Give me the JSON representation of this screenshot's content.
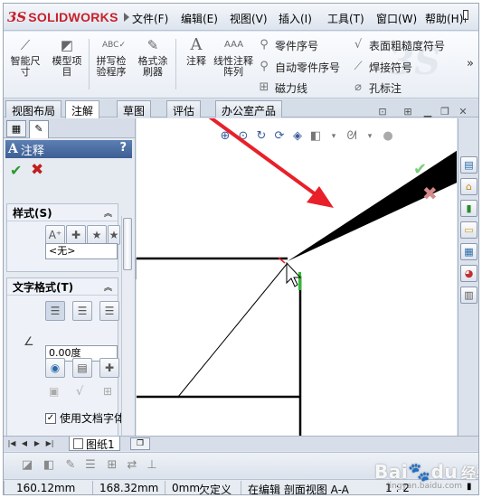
{
  "app": {
    "logo_prefix": "3S",
    "logo_text": "SOLIDWORKS"
  },
  "menu": [
    "文件(F)",
    "编辑(E)",
    "视图(V)",
    "插入(I)",
    "工具(T)",
    "窗口(W)",
    "帮助(H)"
  ],
  "ribbon": {
    "large": [
      {
        "label": "智能尺寸",
        "icon": "smart-dimension-icon"
      },
      {
        "label": "模型项目",
        "icon": "model-items-icon"
      },
      {
        "label": "拼写检验程序",
        "icon": "spell-checker-icon"
      },
      {
        "label": "格式涂刷器",
        "icon": "format-painter-icon"
      },
      {
        "label": "注释",
        "icon": "note-icon"
      },
      {
        "label": "线性注释阵列",
        "icon": "linear-note-pattern-icon"
      }
    ],
    "small_col1": [
      {
        "label": "零件序号",
        "icon": "balloon-icon"
      },
      {
        "label": "自动零件序号",
        "icon": "auto-balloon-icon"
      },
      {
        "label": "磁力线",
        "icon": "magnetic-line-icon"
      }
    ],
    "small_col2": [
      {
        "label": "表面粗糙度符号",
        "icon": "surface-finish-icon"
      },
      {
        "label": "焊接符号",
        "icon": "weld-symbol-icon"
      },
      {
        "label": "孔标注",
        "icon": "hole-callout-icon"
      }
    ],
    "more": "»"
  },
  "tabs": [
    "视图布局",
    "注解",
    "草图",
    "评估",
    "办公室产品"
  ],
  "active_tab": "注解",
  "panel": {
    "title": "注释",
    "help": "?",
    "style_group": {
      "title": "样式(S)",
      "selected": "<无>"
    },
    "text_format_group": {
      "title": "文字格式(T)",
      "angle": "0.00度",
      "use_doc_font": "使用文档字体"
    }
  },
  "sheet": {
    "name": "图纸1"
  },
  "status": {
    "x": "160.12mm",
    "y": "168.32mm",
    "z": "0mm",
    "state": "欠定义",
    "editing": "在编辑 剖面视图 A-A",
    "scale": "1 : 2"
  },
  "watermark": {
    "brand": "Bai",
    "brand_suffix": "du",
    "text": "经验",
    "url": "jingyan.baidu.com"
  },
  "colors": {
    "accent": "#3d5f94",
    "arrow": "#e8202a",
    "ok": "#2c9a2c",
    "cancel": "#c21d1d"
  }
}
